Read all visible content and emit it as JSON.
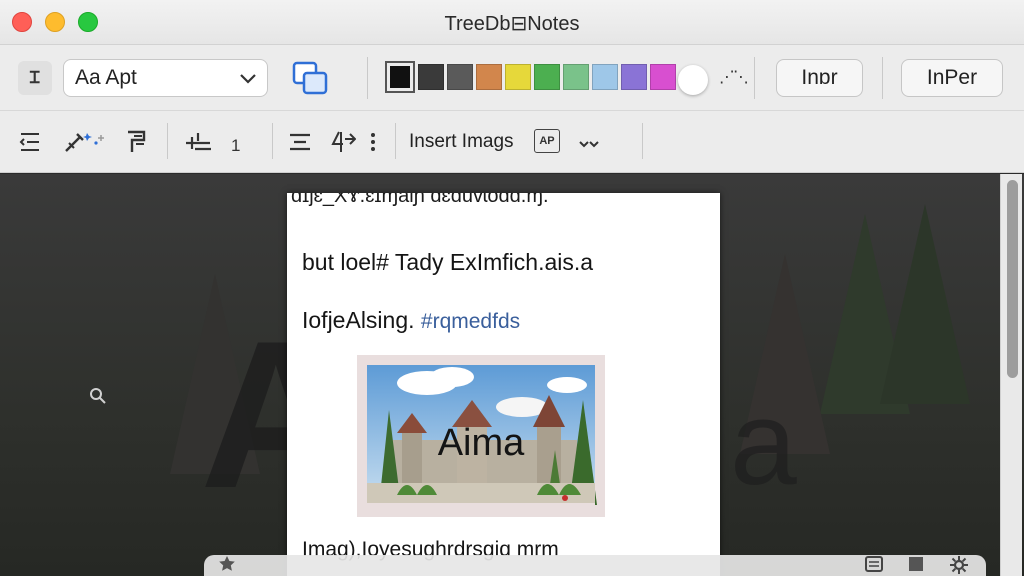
{
  "window": {
    "title": "TreeDb⊟Notes"
  },
  "toolbar1": {
    "mini_label": "Ꮖ",
    "font_select_value": "Aa Apt",
    "swatch_colors": [
      "#111111",
      "#3a3a3a",
      "#5a5a5a",
      "#d2864c",
      "#e6d83a",
      "#4caf50",
      "#7ac28a",
      "#9ec7e8",
      "#8a73d6",
      "#d84fd0"
    ],
    "btn_infr_label": "Inɒr",
    "btn_inper_label": "InPer"
  },
  "toolbar2": {
    "insert_label": "Insert Imags",
    "number_label": "1"
  },
  "document": {
    "cut_line": "ɑ̃ɪjɛ_Xɤ.ɛɪɱaiɲ ɑɛɑuvɩoɑɑ.ɱ.",
    "line1": "but loel# Tady ExImfich.ais.a",
    "line2_text": "IofjeAlsing.",
    "line2_tag": "#rqmedfds",
    "image_text": "Aima",
    "caption": "Imag),Ioyesughrdrsgiɑ mrm"
  },
  "background": {
    "big_text": "A",
    "right_text": "a"
  }
}
